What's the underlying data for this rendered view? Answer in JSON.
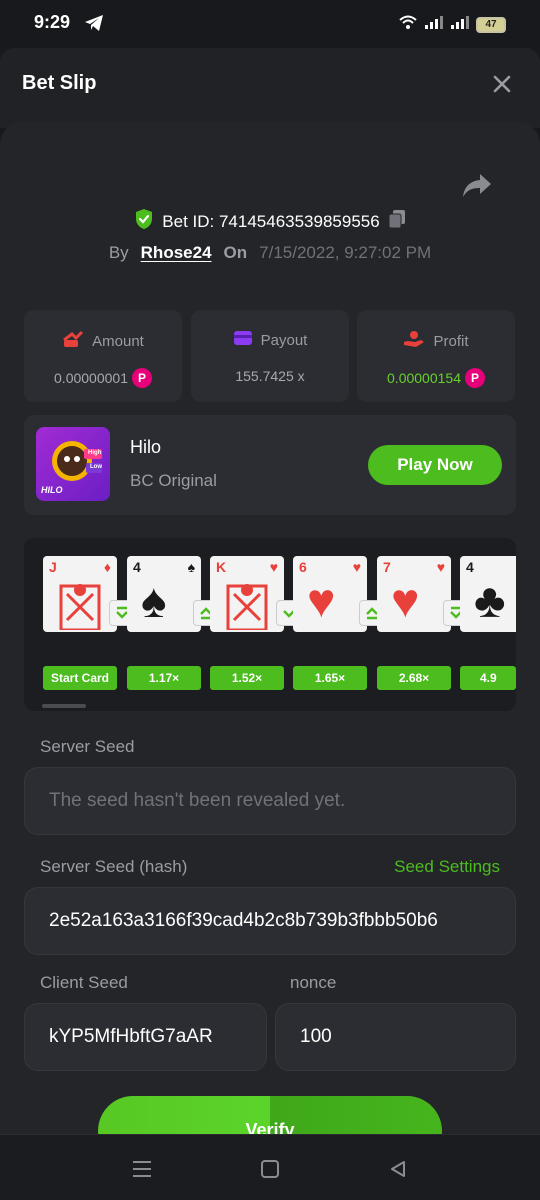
{
  "status": {
    "time": "9:29",
    "battery": "47"
  },
  "header": {
    "title": "Bet Slip"
  },
  "bet": {
    "id_label": "Bet ID: 74145463539859556",
    "by_label": "By",
    "user": "Rhose24",
    "on_label": "On",
    "date": "7/15/2022, 9:27:02 PM"
  },
  "stats": {
    "amount": {
      "label": "Amount",
      "value": "0.00000001"
    },
    "payout": {
      "label": "Payout",
      "value": "155.7425 x"
    },
    "profit": {
      "label": "Profit",
      "value": "0.00000154"
    }
  },
  "game": {
    "name": "Hilo",
    "subtitle": "BC Original",
    "play_label": "Play Now",
    "thumb_text": "HILO",
    "thumb_badge_top": "High",
    "thumb_badge_bottom": "Low"
  },
  "cards": [
    {
      "rank": "J",
      "suit": "♦",
      "color": "red"
    },
    {
      "rank": "4",
      "suit": "♠",
      "color": "black"
    },
    {
      "rank": "K",
      "suit": "♥",
      "color": "red"
    },
    {
      "rank": "6",
      "suit": "♥",
      "color": "red"
    },
    {
      "rank": "7",
      "suit": "♥",
      "color": "red"
    },
    {
      "rank": "4",
      "suit": "♣",
      "color": "black"
    }
  ],
  "multipliers": [
    "Start Card",
    "1.17×",
    "1.52×",
    "1.65×",
    "2.68×",
    "4.9"
  ],
  "seeds": {
    "server_seed_label": "Server Seed",
    "server_seed_placeholder": "The seed hasn't been revealed yet.",
    "server_hash_label": "Server Seed (hash)",
    "seed_settings": "Seed Settings",
    "server_hash": "2e52a163a3166f39cad4b2c8b739b3fbbb50b6",
    "client_seed_label": "Client Seed",
    "client_seed": "kYP5MfHbftG7aAR",
    "nonce_label": "nonce",
    "nonce": "100"
  },
  "verify_label": "Verify",
  "colors": {
    "accent": "#4cbc1e",
    "background": "#18191c",
    "panel": "#232529",
    "card": "#2b2d32"
  }
}
